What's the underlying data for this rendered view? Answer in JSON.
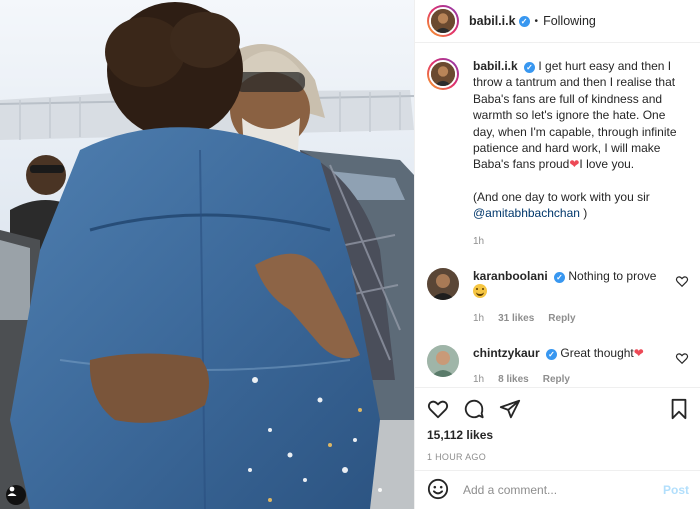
{
  "post": {
    "username": "babil.i.k",
    "verified_icon": "verified-badge-icon",
    "separator": "•",
    "follow_status": "Following",
    "caption": {
      "username": "babil.i.k",
      "text_1": "I get hurt easy and then I throw a tantrum and then I realise that Baba's fans are full of kindness and warmth so let's ignore the hate. One day, when I'm capable, through infinite patience and hard work, I will make Baba's fans proud",
      "heart_1": "❤",
      "text_1b": "I love you.",
      "text_2": "(And one day to work with you sir ",
      "mention": "@amitabhbachchan",
      "text_2b": " )",
      "time": "1h"
    },
    "comments": [
      {
        "username": "karanboolani",
        "text": "Nothing to prove",
        "time": "1h",
        "likes": "31 likes",
        "reply": "Reply"
      },
      {
        "username": "chintzykaur",
        "text": "Great thought",
        "heart": "❤",
        "time": "1h",
        "likes": "8 likes",
        "reply": "Reply"
      }
    ],
    "likes": "15,112 likes",
    "posted_ago": "1 HOUR AGO",
    "add_comment_placeholder": "Add a comment...",
    "post_label": "Post"
  },
  "colors": {
    "link": "#00376b",
    "verified": "#3897f0",
    "muted": "#8e8e8e",
    "post_button_disabled": "#b2dffc",
    "heart": "#ed4956"
  },
  "icons": [
    "heart-icon",
    "comment-icon",
    "share-icon",
    "bookmark-icon",
    "emoji-icon",
    "tag-people-icon"
  ]
}
